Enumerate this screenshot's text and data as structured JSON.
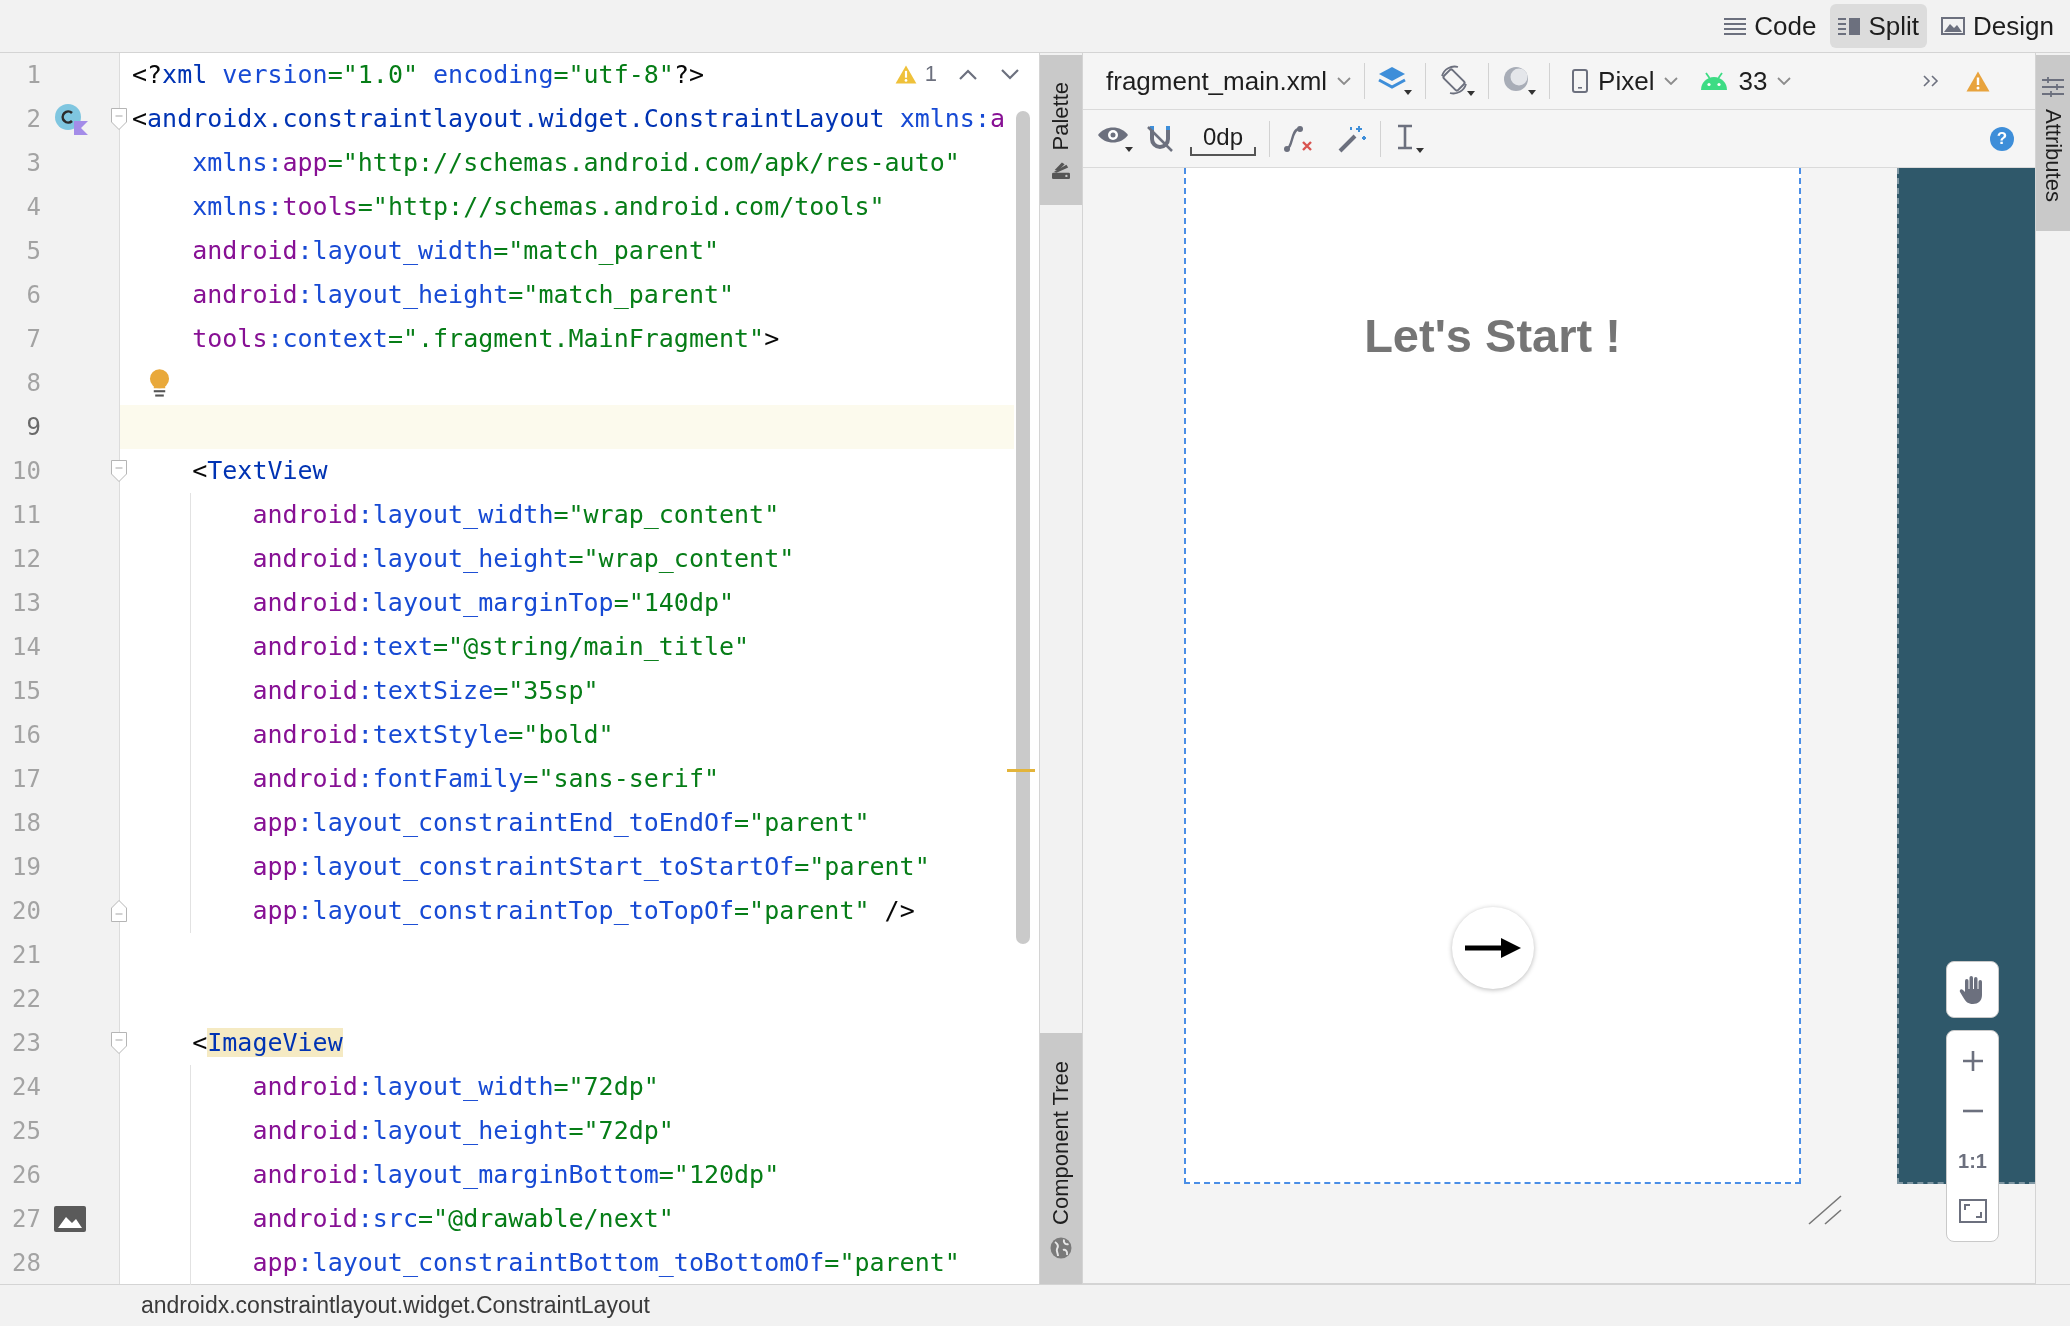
{
  "view_modes": [
    {
      "kind": "code",
      "label": "Code",
      "selected": false
    },
    {
      "kind": "split",
      "label": "Split",
      "selected": true
    },
    {
      "kind": "design",
      "label": "Design",
      "selected": false
    }
  ],
  "editor": {
    "warning_count": "1",
    "lines": [
      {
        "number": "1",
        "kind": "plain",
        "current": false,
        "tokens": [
          {
            "kind": "punct",
            "text": "<?"
          },
          {
            "kind": "tag",
            "text": "xml"
          },
          {
            "kind": "attr",
            "text": " version"
          },
          {
            "kind": "value",
            "text": "=\"1.0\""
          },
          {
            "kind": "attr",
            "text": " encoding"
          },
          {
            "kind": "value",
            "text": "=\"utf-8\""
          },
          {
            "kind": "punct",
            "text": "?>"
          }
        ]
      },
      {
        "number": "2",
        "kind": "class_ref",
        "current": false,
        "tokens": [
          {
            "kind": "punct",
            "text": "<"
          },
          {
            "kind": "tag",
            "text": "androidx.constraintlayout.widget.ConstraintLayout"
          },
          {
            "kind": "attr",
            "text": " xmlns:"
          },
          {
            "kind": "ns",
            "text": "a"
          }
        ],
        "children": [
          {
            "number": "3",
            "kind": "plain",
            "current": false,
            "tokens": [
              {
                "kind": "attr",
                "text": "xmlns:"
              },
              {
                "kind": "ns",
                "text": "app"
              },
              {
                "kind": "value",
                "text": "=\"http://schemas.android.com/apk/res-auto\""
              }
            ]
          },
          {
            "number": "4",
            "kind": "plain",
            "current": false,
            "tokens": [
              {
                "kind": "attr",
                "text": "xmlns:"
              },
              {
                "kind": "ns",
                "text": "tools"
              },
              {
                "kind": "value",
                "text": "=\"http://schemas.android.com/tools\""
              }
            ]
          },
          {
            "number": "5",
            "kind": "plain",
            "current": false,
            "tokens": [
              {
                "kind": "ns",
                "text": "android"
              },
              {
                "kind": "attr",
                "text": ":layout_width"
              },
              {
                "kind": "value",
                "text": "=\"match_parent\""
              }
            ]
          },
          {
            "number": "6",
            "kind": "plain",
            "current": false,
            "tokens": [
              {
                "kind": "ns",
                "text": "android"
              },
              {
                "kind": "attr",
                "text": ":layout_height"
              },
              {
                "kind": "value",
                "text": "=\"match_parent\""
              }
            ]
          },
          {
            "number": "7",
            "kind": "plain",
            "current": false,
            "tokens": [
              {
                "kind": "ns",
                "text": "tools"
              },
              {
                "kind": "attr",
                "text": ":context"
              },
              {
                "kind": "value",
                "text": "=\".fragment.MainFragment\""
              },
              {
                "kind": "punct",
                "text": ">"
              }
            ]
          },
          {
            "number": "8",
            "kind": "intention",
            "current": false
          },
          {
            "number": "9",
            "kind": "plain",
            "current": true
          },
          {
            "number": "10",
            "kind": "plain",
            "current": false,
            "tokens": [
              {
                "kind": "punct",
                "text": "<"
              },
              {
                "kind": "tag",
                "text": "TextView"
              }
            ],
            "children": [
              {
                "number": "11",
                "kind": "plain",
                "current": false,
                "tokens": [
                  {
                    "kind": "ns",
                    "text": "android"
                  },
                  {
                    "kind": "attr",
                    "text": ":layout_width"
                  },
                  {
                    "kind": "value",
                    "text": "=\"wrap_content\""
                  }
                ]
              },
              {
                "number": "12",
                "kind": "plain",
                "current": false,
                "tokens": [
                  {
                    "kind": "ns",
                    "text": "android"
                  },
                  {
                    "kind": "attr",
                    "text": ":layout_height"
                  },
                  {
                    "kind": "value",
                    "text": "=\"wrap_content\""
                  }
                ]
              },
              {
                "number": "13",
                "kind": "plain",
                "current": false,
                "tokens": [
                  {
                    "kind": "ns",
                    "text": "android"
                  },
                  {
                    "kind": "attr",
                    "text": ":layout_marginTop"
                  },
                  {
                    "kind": "value",
                    "text": "=\"140dp\""
                  }
                ]
              },
              {
                "number": "14",
                "kind": "plain",
                "current": false,
                "tokens": [
                  {
                    "kind": "ns",
                    "text": "android"
                  },
                  {
                    "kind": "attr",
                    "text": ":text"
                  },
                  {
                    "kind": "value",
                    "text": "=\"@string/main_title\""
                  }
                ]
              },
              {
                "number": "15",
                "kind": "plain",
                "current": false,
                "tokens": [
                  {
                    "kind": "ns",
                    "text": "android"
                  },
                  {
                    "kind": "attr",
                    "text": ":textSize"
                  },
                  {
                    "kind": "value",
                    "text": "=\"35sp\""
                  }
                ]
              },
              {
                "number": "16",
                "kind": "plain",
                "current": false,
                "tokens": [
                  {
                    "kind": "ns",
                    "text": "android"
                  },
                  {
                    "kind": "attr",
                    "text": ":textStyle"
                  },
                  {
                    "kind": "value",
                    "text": "=\"bold\""
                  }
                ]
              },
              {
                "number": "17",
                "kind": "plain",
                "current": false,
                "tokens": [
                  {
                    "kind": "ns",
                    "text": "android"
                  },
                  {
                    "kind": "attr",
                    "text": ":fontFamily"
                  },
                  {
                    "kind": "value",
                    "text": "=\"sans-serif\""
                  }
                ]
              },
              {
                "number": "18",
                "kind": "plain",
                "current": false,
                "tokens": [
                  {
                    "kind": "ns",
                    "text": "app"
                  },
                  {
                    "kind": "attr",
                    "text": ":layout_constraintEnd_toEndOf"
                  },
                  {
                    "kind": "value",
                    "text": "=\"parent\""
                  }
                ]
              },
              {
                "number": "19",
                "kind": "plain",
                "current": false,
                "tokens": [
                  {
                    "kind": "ns",
                    "text": "app"
                  },
                  {
                    "kind": "attr",
                    "text": ":layout_constraintStart_toStartOf"
                  },
                  {
                    "kind": "value",
                    "text": "=\"parent\""
                  }
                ]
              },
              {
                "number": "20",
                "kind": "fold_end",
                "current": false,
                "tokens": [
                  {
                    "kind": "ns",
                    "text": "app"
                  },
                  {
                    "kind": "attr",
                    "text": ":layout_constraintTop_toTopOf"
                  },
                  {
                    "kind": "value",
                    "text": "=\"parent\""
                  },
                  {
                    "kind": "punct",
                    "text": " />"
                  }
                ]
              }
            ]
          },
          {
            "number": "21",
            "kind": "plain",
            "current": false
          },
          {
            "number": "22",
            "kind": "plain",
            "current": false
          },
          {
            "number": "23",
            "kind": "plain",
            "current": false,
            "tokens": [
              {
                "kind": "punct",
                "text": "<"
              },
              {
                "kind": "match",
                "text": "ImageView"
              }
            ],
            "children": [
              {
                "number": "24",
                "kind": "plain",
                "current": false,
                "tokens": [
                  {
                    "kind": "ns",
                    "text": "android"
                  },
                  {
                    "kind": "attr",
                    "text": ":layout_width"
                  },
                  {
                    "kind": "value",
                    "text": "=\"72dp\""
                  }
                ]
              },
              {
                "number": "25",
                "kind": "plain",
                "current": false,
                "tokens": [
                  {
                    "kind": "ns",
                    "text": "android"
                  },
                  {
                    "kind": "attr",
                    "text": ":layout_height"
                  },
                  {
                    "kind": "value",
                    "text": "=\"72dp\""
                  }
                ]
              },
              {
                "number": "26",
                "kind": "plain",
                "current": false,
                "tokens": [
                  {
                    "kind": "ns",
                    "text": "android"
                  },
                  {
                    "kind": "attr",
                    "text": ":layout_marginBottom"
                  },
                  {
                    "kind": "value",
                    "text": "=\"120dp\""
                  }
                ]
              },
              {
                "number": "27",
                "kind": "drawable_ref",
                "current": false,
                "tokens": [
                  {
                    "kind": "ns",
                    "text": "android"
                  },
                  {
                    "kind": "attr",
                    "text": ":src"
                  },
                  {
                    "kind": "value",
                    "text": "=\"@drawable/next\""
                  }
                ]
              },
              {
                "number": "28",
                "kind": "plain",
                "current": false,
                "tokens": [
                  {
                    "kind": "ns",
                    "text": "app"
                  },
                  {
                    "kind": "attr",
                    "text": ":layout_constraintBottom_toBottomOf"
                  },
                  {
                    "kind": "value",
                    "text": "=\"parent\""
                  }
                ]
              }
            ]
          }
        ]
      }
    ]
  },
  "tool_strip_left": [
    {
      "kind": "palette",
      "label": "Palette"
    },
    {
      "kind": "component_tree",
      "label": "Component Tree"
    }
  ],
  "design": {
    "toolbar": {
      "file": "fragment_main.xml",
      "device": "Pixel",
      "api_level": "33",
      "margin": "0dp",
      "help": "?"
    },
    "preview": {
      "title": "Let's Start !"
    },
    "zoom_controls": {
      "actual_size": "1:1"
    }
  },
  "tool_strip_right": [
    {
      "kind": "attributes",
      "label": "Attributes"
    }
  ],
  "status_bar": {
    "path": "androidx.constraintlayout.widget.ConstraintLayout"
  }
}
